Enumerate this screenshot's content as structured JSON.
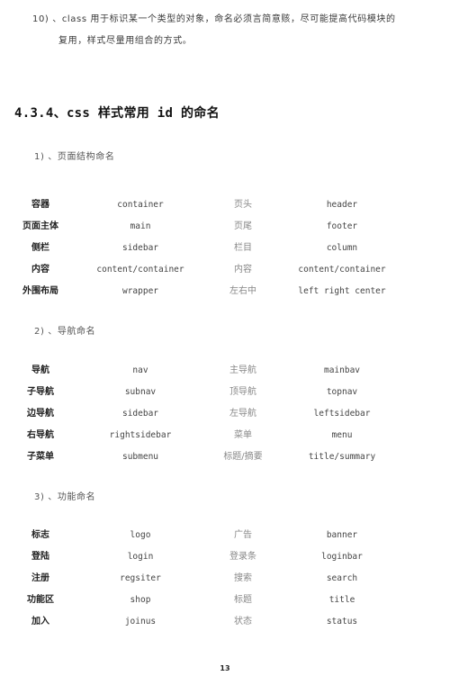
{
  "paragraph": {
    "number": "10)",
    "line1": "、class 用于标识某一个类型的对象，命名必须言简意赅，尽可能提高代码模块的",
    "line2": "复用，样式尽量用组合的方式。"
  },
  "section_heading": "4.3.4、css 样式常用 id 的命名",
  "sections": [
    {
      "title": "1)  、页面结构命名",
      "rows": [
        [
          "容器",
          "container",
          "页头",
          "header"
        ],
        [
          "页面主体",
          "main",
          "页尾",
          "footer"
        ],
        [
          "侧栏",
          "sidebar",
          "栏目",
          "column"
        ],
        [
          "内容",
          "content/container",
          "内容",
          "content/container"
        ],
        [
          "外围布局",
          "wrapper",
          "左右中",
          "left right center"
        ]
      ]
    },
    {
      "title": "2)  、导航命名",
      "rows": [
        [
          "导航",
          "nav",
          "主导航",
          "mainbav"
        ],
        [
          "子导航",
          "subnav",
          "顶导航",
          "topnav"
        ],
        [
          "边导航",
          "sidebar",
          "左导航",
          "leftsidebar"
        ],
        [
          "右导航",
          "rightsidebar",
          "菜单",
          "menu"
        ],
        [
          "子菜单",
          "submenu",
          "标题/摘要",
          "title/summary"
        ]
      ]
    },
    {
      "title": "3)  、功能命名",
      "rows": [
        [
          "标志",
          "logo",
          "广告",
          "banner"
        ],
        [
          "登陆",
          "login",
          "登录条",
          "loginbar"
        ],
        [
          "注册",
          "regsiter",
          "搜索",
          "search"
        ],
        [
          "功能区",
          "shop",
          "标题",
          "title"
        ],
        [
          "加入",
          "joinus",
          "状态",
          "status"
        ]
      ]
    }
  ],
  "page_number": "13"
}
